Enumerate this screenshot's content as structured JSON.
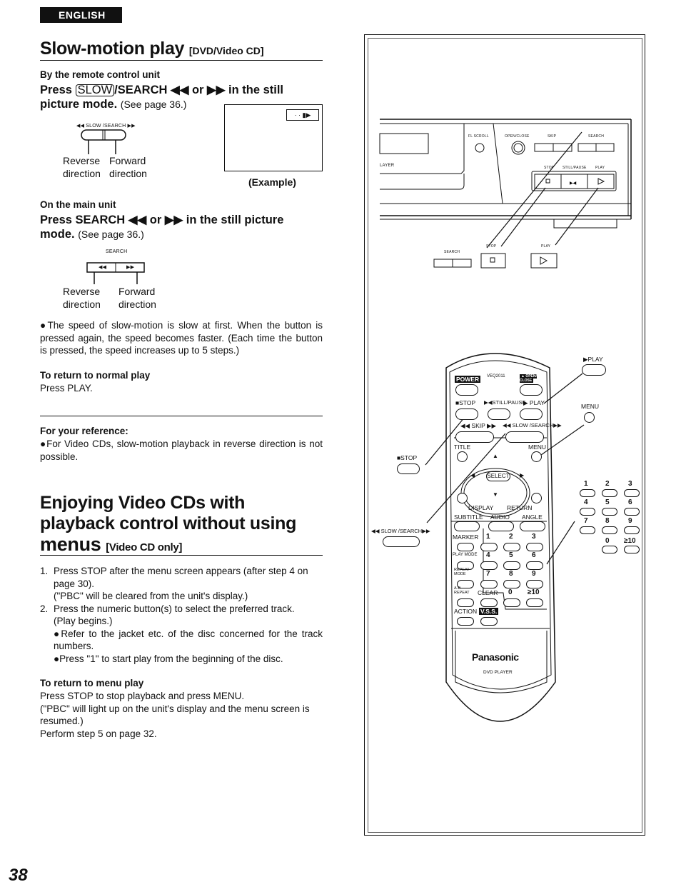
{
  "page": {
    "language_tab": "ENGLISH",
    "page_number": "38"
  },
  "section1": {
    "title": "Slow-motion play",
    "title_tag": "[DVD/Video CD]",
    "remote": {
      "subheading": "By the remote control unit",
      "instruction_pre": "Press",
      "slow_key": "SLOW",
      "instruction_post": "/SEARCH ◀◀ or ▶▶ in the still",
      "instruction_line2": "picture mode.",
      "see_page": "(See page 36.)",
      "diagram_label": "◀◀ SLOW /SEARCH ▶▶",
      "reverse_label": [
        "Reverse",
        "direction"
      ],
      "forward_label": [
        "Forward",
        "direction"
      ],
      "example_caption": "(Example)",
      "example_osd": "· · ▮▶"
    },
    "main_unit": {
      "subheading": "On the main unit",
      "instruction": "Press SEARCH ◀◀ or ▶▶ in the still picture",
      "instruction_line2": "mode.",
      "see_page": "(See page 36.)",
      "diagram_label": "SEARCH",
      "rev_key": "◀◀",
      "fwd_key": "▶▶",
      "reverse_label": [
        "Reverse",
        "direction"
      ],
      "forward_label": [
        "Forward",
        "direction"
      ]
    },
    "note": "●The speed of slow-motion is slow at first. When the button is pressed again, the speed becomes faster. (Each time the button is pressed, the speed increases up to 5 steps.)",
    "return_normal": {
      "heading": "To return to normal play",
      "text": "Press PLAY."
    },
    "reference": {
      "heading": "For your reference:",
      "text": "●For Video CDs, slow-motion playback in reverse direction is not possible."
    }
  },
  "section2": {
    "title_lines": [
      "Enjoying Video CDs with",
      "playback control without using"
    ],
    "title_last": "menus",
    "title_tag": "[Video CD only]",
    "steps": [
      {
        "num": "1.",
        "lines": [
          "Press STOP after the menu screen appears (after step 4 on page 30).",
          "(\"PBC\" will be cleared from the unit's display.)"
        ]
      },
      {
        "num": "2.",
        "lines": [
          "Press the numeric button(s) to select the preferred track.",
          "(Play begins.)"
        ],
        "bullets": [
          "●Refer to the jacket etc. of the disc concerned for the track numbers.",
          "●Press \"1\" to start play from the beginning of the disc."
        ]
      }
    ],
    "return_menu": {
      "heading": "To return to menu play",
      "lines": [
        "Press STOP to stop playback and press MENU.",
        "(\"PBC\" will light up on the unit's display and the menu screen is resumed.)",
        "Perform step 5 on page 32."
      ]
    }
  },
  "illustration": {
    "front_panel": {
      "model_text": "LAYER",
      "fl_scroll": "FL SCROLL",
      "open_close": "OPEN/CLOSE",
      "skip": "SKIP",
      "search": "SEARCH",
      "stop": "STOP",
      "still_pause": "STILL/PAUSE",
      "play": "PLAY"
    },
    "callouts": {
      "search": "SEARCH",
      "stop": "STOP",
      "play": "PLAY",
      "remote_play": "▶PLAY",
      "remote_menu": "MENU",
      "remote_stop": "■STOP",
      "remote_slow": "◀◀ SLOW /SEARCH▶▶",
      "numbers": [
        "1",
        "2",
        "3",
        "4",
        "5",
        "6",
        "7",
        "8",
        "9",
        "0",
        "≥10"
      ]
    },
    "remote": {
      "power": "POWER",
      "model": "VEQ2011",
      "open_close": "▲ OPEN/ CLOSE",
      "stop": "■STOP",
      "still_pause": "▶◀STILL/PAUSE",
      "play": "▶ PLAY",
      "skip": "◀◀ SKIP ▶▶",
      "slow_search": "◀◀ SLOW /SEARCH▶▶",
      "title": "TITLE",
      "menu": "MENU",
      "select": "SELECT",
      "display": "DISPLAY",
      "return": "RETURN",
      "subtitle": "SUBTITLE",
      "audio": "AUDIO",
      "angle": "ANGLE",
      "marker": "MARKER",
      "play_mode": "PLAY MODE",
      "repeat_mode": "REPEAT MODE",
      "ab_repeat": "A-B REPEAT",
      "clear": "CLEAR",
      "action": "ACTION",
      "vss": "V.S.S.",
      "keypad": [
        "1",
        "2",
        "3",
        "4",
        "5",
        "6",
        "7",
        "8",
        "9",
        "0",
        "≥10"
      ],
      "brand": "Panasonic",
      "product": "DVD PLAYER"
    }
  }
}
